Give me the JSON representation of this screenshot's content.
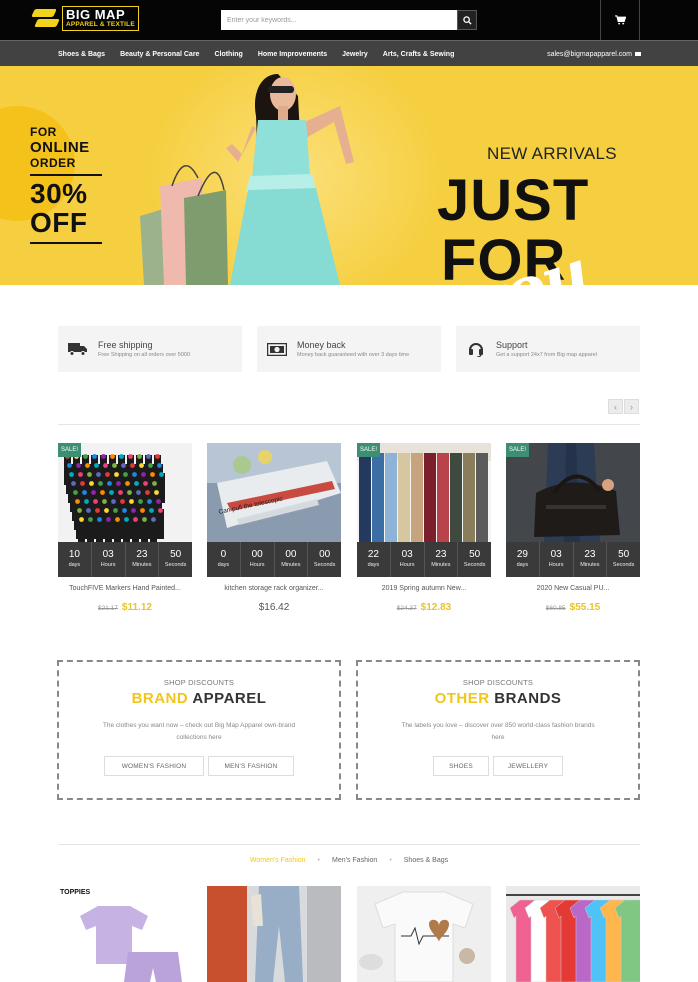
{
  "header": {
    "logo_title": "BIG MAP",
    "logo_subtitle": "APPAREL & TEXTILE",
    "search_placeholder": "Enter your keywords...",
    "accent_color": "#f2d21b"
  },
  "nav": {
    "items": [
      "Shoes & Bags",
      "Beauty & Personal Care",
      "Clothing",
      "Home Improvements",
      "Jewelry",
      "Arts, Crafts & Sewing"
    ],
    "email": "sales@bigmapapparel.com"
  },
  "hero": {
    "promo_line1": "FOR",
    "promo_line2": "ONLINE",
    "promo_line3": "ORDER",
    "promo_line4": "30%",
    "promo_line5": "OFF",
    "new_arrivals": "NEW ARRIVALS",
    "just": "JUST",
    "for": "FOR",
    "you": "you"
  },
  "features": [
    {
      "title": "Free shipping",
      "desc": "Free Shipping on all orders over 5000",
      "icon": "truck-icon"
    },
    {
      "title": "Money back",
      "desc": "Money back guaranteed with over 3 days time",
      "icon": "money-icon"
    },
    {
      "title": "Support",
      "desc": "Get a support 24x7 from Big map apparel",
      "icon": "headset-icon"
    }
  ],
  "countdown_units": [
    "days",
    "Hours",
    "Minutes",
    "Seconds"
  ],
  "products": [
    {
      "name": "TouchFIVE Markers Hand Painted...",
      "sale": "SALE!",
      "old_price": "$21.17",
      "price": "$11.12",
      "countdown": [
        "10",
        "03",
        "23",
        "50"
      ]
    },
    {
      "name": "kitchen storage rack organizer...",
      "sale": "",
      "old_price": "",
      "price": "$16.42",
      "countdown": [
        "0",
        "00",
        "00",
        "00"
      ]
    },
    {
      "name": "2019 Spring autumn New...",
      "sale": "SALE!",
      "old_price": "$24.37",
      "price": "$12.83",
      "countdown": [
        "22",
        "03",
        "23",
        "50"
      ]
    },
    {
      "name": "2020 New Casual PU...",
      "sale": "SALE!",
      "old_price": "$60.85",
      "price": "$55.15",
      "countdown": [
        "29",
        "03",
        "23",
        "50"
      ]
    }
  ],
  "product_image_caption": "Can pull the telescopic",
  "discounts": [
    {
      "top": "SHOP DISCOUNTS",
      "highlight": "BRAND",
      "rest": " APPAREL",
      "desc": "The clothes you want now – check out Big Map Apparel own-brand collections here",
      "buttons": [
        "WOMEN'S FASHION",
        "MEN'S FASHION"
      ]
    },
    {
      "top": "SHOP DISCOUNTS",
      "highlight": "OTHER",
      "rest": " BRANDS",
      "desc": "The labels you love – discover over 850 world-class fashion brands here",
      "buttons": [
        "SHOES",
        "JEWELLERY"
      ]
    }
  ],
  "tabs": [
    "Women's Fashion",
    "Men's Fashion",
    "Shoes & Bags"
  ],
  "bottom_label": "TOPPIES"
}
